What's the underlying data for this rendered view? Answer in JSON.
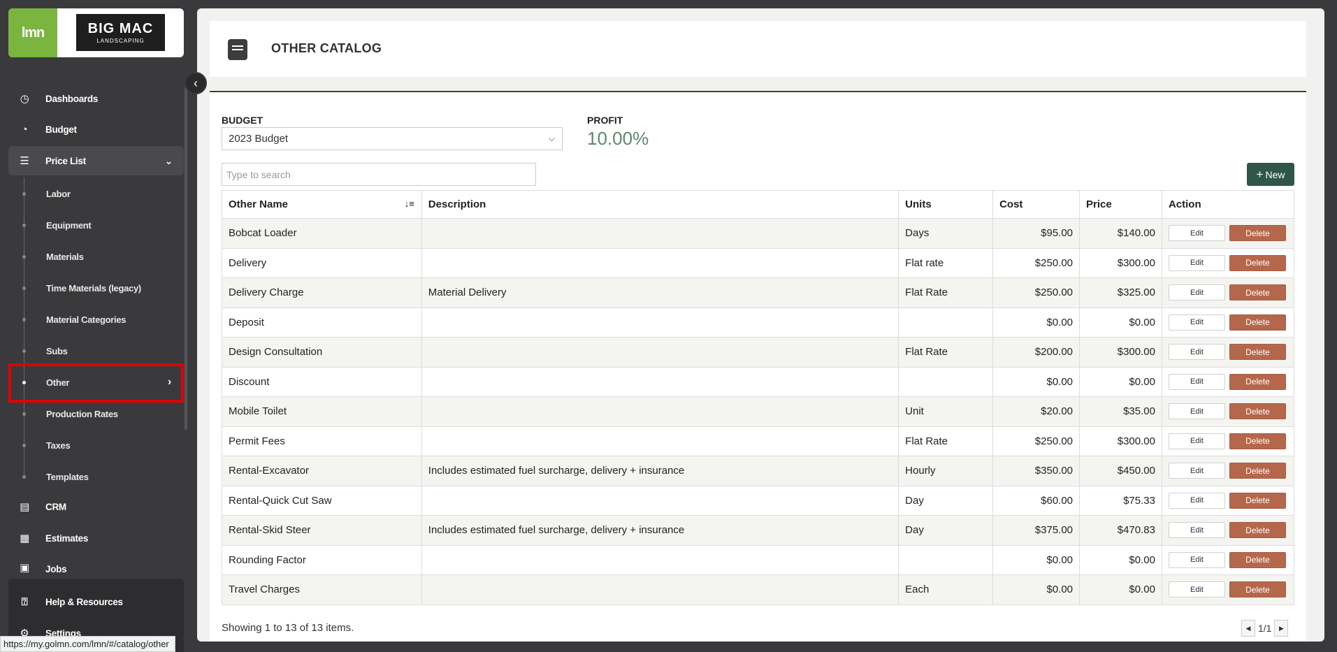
{
  "brand": {
    "lmn_label": "lmn",
    "client_line1": "BIG MAC",
    "client_line2": "LANDSCAPING"
  },
  "nav": {
    "dashboards": "Dashboards",
    "budget": "Budget",
    "price_list": "Price List",
    "sub": [
      "Labor",
      "Equipment",
      "Materials",
      "Time Materials (legacy)",
      "Material Categories",
      "Subs",
      "Other",
      "Production Rates",
      "Taxes",
      "Templates"
    ],
    "crm": "CRM",
    "estimates": "Estimates",
    "jobs": "Jobs",
    "help": "Help & Resources",
    "settings": "Settings"
  },
  "status_url": "https://my.golmn.com/lmn/#/catalog/other",
  "page": {
    "title": "OTHER CATALOG",
    "budget_label": "BUDGET",
    "budget_value": "2023 Budget",
    "profit_label": "PROFIT",
    "profit_value": "10.00%",
    "search_placeholder": "Type to search",
    "new_label": "New"
  },
  "table": {
    "columns": [
      "Other Name",
      "Description",
      "Units",
      "Cost",
      "Price",
      "Action"
    ],
    "edit_label": "Edit",
    "delete_label": "Delete",
    "rows": [
      {
        "name": "Bobcat Loader",
        "description": "",
        "units": "Days",
        "cost": "$95.00",
        "price": "$140.00"
      },
      {
        "name": "Delivery",
        "description": "",
        "units": "Flat rate",
        "cost": "$250.00",
        "price": "$300.00"
      },
      {
        "name": "Delivery Charge",
        "description": "Material Delivery",
        "units": "Flat Rate",
        "cost": "$250.00",
        "price": "$325.00"
      },
      {
        "name": "Deposit",
        "description": "",
        "units": "",
        "cost": "$0.00",
        "price": "$0.00"
      },
      {
        "name": "Design Consultation",
        "description": "",
        "units": "Flat Rate",
        "cost": "$200.00",
        "price": "$300.00"
      },
      {
        "name": "Discount",
        "description": "",
        "units": "",
        "cost": "$0.00",
        "price": "$0.00"
      },
      {
        "name": "Mobile Toilet",
        "description": "",
        "units": "Unit",
        "cost": "$20.00",
        "price": "$35.00"
      },
      {
        "name": "Permit Fees",
        "description": "",
        "units": "Flat Rate",
        "cost": "$250.00",
        "price": "$300.00"
      },
      {
        "name": "Rental-Excavator",
        "description": "Includes estimated fuel surcharge, delivery + insurance",
        "units": "Hourly",
        "cost": "$350.00",
        "price": "$450.00"
      },
      {
        "name": "Rental-Quick Cut Saw",
        "description": "",
        "units": "Day",
        "cost": "$60.00",
        "price": "$75.33"
      },
      {
        "name": "Rental-Skid Steer",
        "description": "Includes estimated fuel surcharge, delivery + insurance",
        "units": "Day",
        "cost": "$375.00",
        "price": "$470.83"
      },
      {
        "name": "Rounding Factor",
        "description": "",
        "units": "",
        "cost": "$0.00",
        "price": "$0.00"
      },
      {
        "name": "Travel Charges",
        "description": "",
        "units": "Each",
        "cost": "$0.00",
        "price": "$0.00"
      }
    ]
  },
  "footer": {
    "showing": "Showing 1 to 13 of 13 items.",
    "pager": "1/1"
  }
}
